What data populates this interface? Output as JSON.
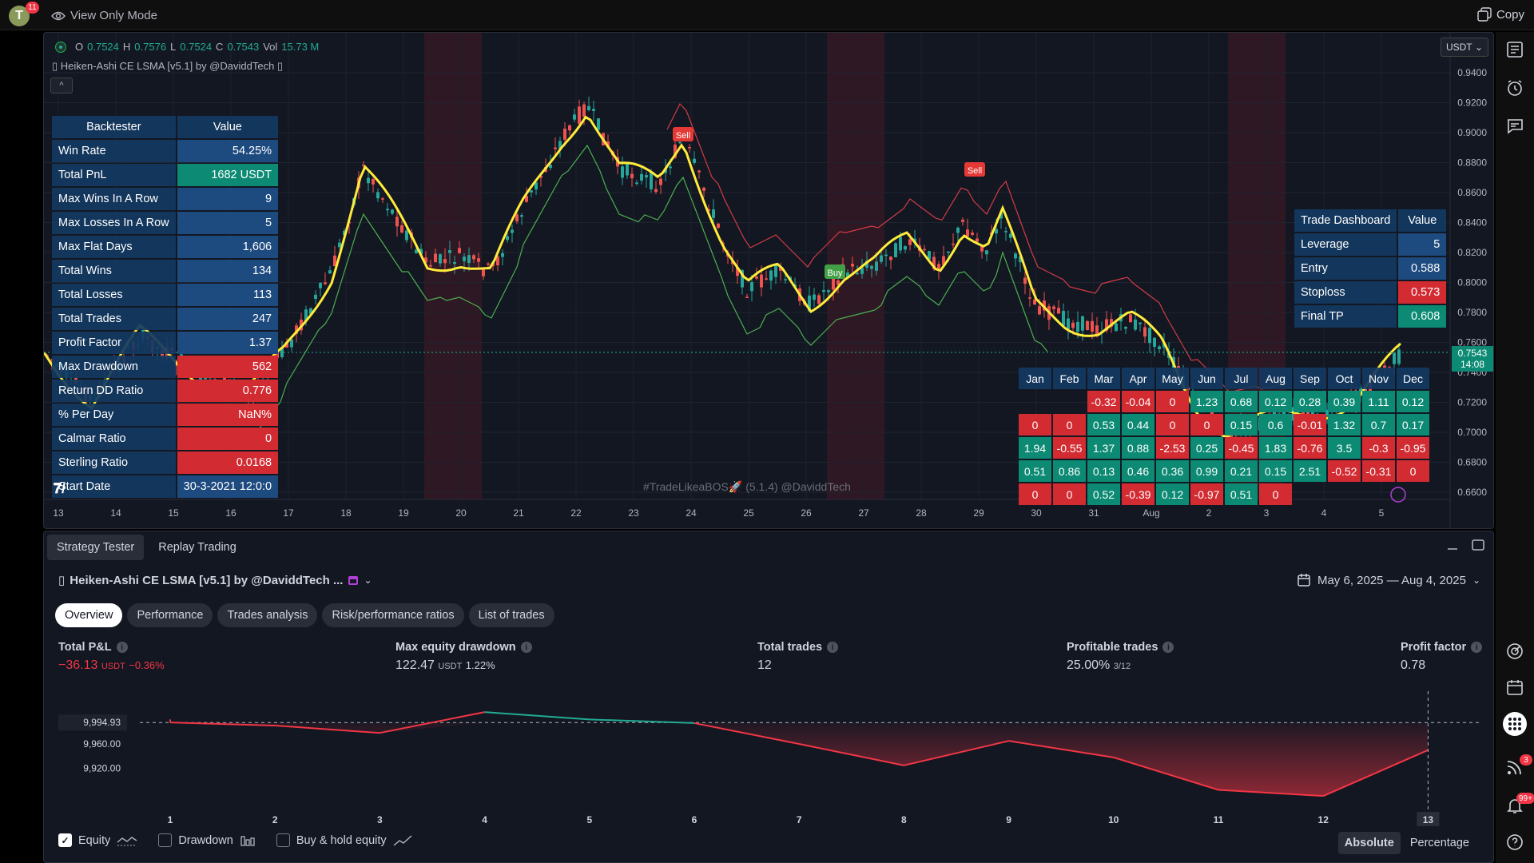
{
  "topbar": {
    "avatar_letter": "T",
    "avatar_badge": "11",
    "view_mode": "View Only Mode",
    "copy_label": "Copy"
  },
  "chart": {
    "ohlc": {
      "o_label": "O",
      "o": "0.7524",
      "h_label": "H",
      "h": "0.7576",
      "l_label": "L",
      "l": "0.7524",
      "c_label": "C",
      "c": "0.7543",
      "vol_label": "Vol",
      "vol": "15.73 M"
    },
    "indicator_title": "Heiken-Ashi CE LSMA [v5.1] by @DaviddTech",
    "currency": "USDT",
    "watermark": "#TradeLikeaBOS🚀 (5.1.4) @DaviddTech",
    "price_labels": [
      "0.9400",
      "0.9200",
      "0.9000",
      "0.8800",
      "0.8600",
      "0.8400",
      "0.8200",
      "0.8000",
      "0.7800",
      "0.7600",
      "0.7400",
      "0.7200",
      "0.7000",
      "0.6800",
      "0.6600"
    ],
    "current_price": "0.7543",
    "current_time": "14:08",
    "time_labels": [
      "13",
      "14",
      "15",
      "16",
      "17",
      "18",
      "19",
      "20",
      "21",
      "22",
      "23",
      "24",
      "25",
      "26",
      "27",
      "28",
      "29",
      "30",
      "31",
      "Aug",
      "2",
      "3",
      "4",
      "5"
    ],
    "signals": [
      {
        "label": "Sell"
      },
      {
        "label": "Sell"
      },
      {
        "label": "Buy"
      }
    ],
    "colors": {
      "up": "#26a69a",
      "down": "#ef5350",
      "lsma": "#ffeb3b",
      "bg": "#131722"
    }
  },
  "backtester": {
    "header_key": "Backtester",
    "header_val": "Value",
    "rows": [
      {
        "k": "Win Rate",
        "v": "54.25%",
        "c": "blue"
      },
      {
        "k": "Total PnL",
        "v": "1682 USDT",
        "c": "teal"
      },
      {
        "k": "Max Wins In A Row",
        "v": "9",
        "c": "blue"
      },
      {
        "k": "Max Losses In A Row",
        "v": "5",
        "c": "blue"
      },
      {
        "k": "Max Flat Days",
        "v": "1,606",
        "c": "blue"
      },
      {
        "k": "Total Wins",
        "v": "134",
        "c": "blue"
      },
      {
        "k": "Total Losses",
        "v": "113",
        "c": "blue"
      },
      {
        "k": "Total Trades",
        "v": "247",
        "c": "blue"
      },
      {
        "k": "Profit Factor",
        "v": "1.37",
        "c": "blue"
      },
      {
        "k": "Max Drawdown",
        "v": "562",
        "c": "red"
      },
      {
        "k": "Return DD Ratio",
        "v": "0.776",
        "c": "red"
      },
      {
        "k": "% Per Day",
        "v": "NaN%",
        "c": "red"
      },
      {
        "k": "Calmar Ratio",
        "v": "0",
        "c": "red"
      },
      {
        "k": "Sterling Ratio",
        "v": "0.0168",
        "c": "red"
      },
      {
        "k": "Start Date",
        "v": "30-3-2021 12:0:0",
        "c": "blue"
      }
    ]
  },
  "trade_dashboard": {
    "header_key": "Trade Dashboard",
    "header_val": "Value",
    "rows": [
      {
        "k": "Leverage",
        "v": "5",
        "c": "blue"
      },
      {
        "k": "Entry",
        "v": "0.588",
        "c": "blue"
      },
      {
        "k": "Stoploss",
        "v": "0.573",
        "c": "red"
      },
      {
        "k": "Final TP",
        "v": "0.608",
        "c": "teal"
      }
    ]
  },
  "monthly": {
    "months": [
      "Jan",
      "Feb",
      "Mar",
      "Apr",
      "May",
      "Jun",
      "Jul",
      "Aug",
      "Sep",
      "Oct",
      "Nov",
      "Dec"
    ],
    "rows": [
      [
        "",
        "",
        "-0.32",
        "-0.04",
        "0",
        "1.23",
        "0.68",
        "0.12",
        "0.28",
        "0.39",
        "1.11",
        "0.12"
      ],
      [
        "0",
        "0",
        "0.53",
        "0.44",
        "0",
        "0",
        "0.15",
        "0.6",
        "-0.01",
        "1.32",
        "0.7",
        "0.17"
      ],
      [
        "1.94",
        "-0.55",
        "1.37",
        "0.88",
        "-2.53",
        "0.25",
        "-0.45",
        "1.83",
        "-0.76",
        "3.5",
        "-0.3",
        "-0.95"
      ],
      [
        "0.51",
        "0.86",
        "0.13",
        "0.46",
        "0.36",
        "0.99",
        "0.21",
        "0.15",
        "2.51",
        "-0.52",
        "-0.31",
        "0"
      ],
      [
        "0",
        "0",
        "0.52",
        "-0.39",
        "0.12",
        "-0.97",
        "0.51",
        "0",
        "",
        "",
        "",
        ""
      ]
    ]
  },
  "right_toolbar": {
    "badge_feed": "3",
    "badge_notif": "99+"
  },
  "bottom": {
    "tabs": [
      {
        "label": "Strategy Tester"
      },
      {
        "label": "Replay Trading"
      }
    ],
    "strategy_name": "Heiken-Ashi CE LSMA [v5.1] by @DaviddTech ...",
    "date_range": "May 6, 2025 — Aug 4, 2025",
    "subtabs": [
      {
        "label": "Overview"
      },
      {
        "label": "Performance"
      },
      {
        "label": "Trades analysis"
      },
      {
        "label": "Risk/performance ratios"
      },
      {
        "label": "List of trades"
      }
    ],
    "metrics": {
      "pnl": {
        "label": "Total P&L",
        "value": "−36.13",
        "unit": "USDT",
        "pct": "−0.36%"
      },
      "dd": {
        "label": "Max equity drawdown",
        "value": "122.47",
        "unit": "USDT",
        "pct": "1.22%"
      },
      "trades": {
        "label": "Total trades",
        "value": "12"
      },
      "profitable": {
        "label": "Profitable trades",
        "value": "25.00%",
        "sub": "3/12"
      },
      "pf": {
        "label": "Profit factor",
        "value": "0.78"
      }
    },
    "legend": {
      "equity": "Equity",
      "drawdown": "Drawdown",
      "buyhold": "Buy & hold equity"
    },
    "mode": {
      "absolute": "Absolute",
      "percentage": "Percentage"
    }
  },
  "chart_data": {
    "type": "line",
    "title": "",
    "xlabel": "",
    "ylabel": "",
    "x": [
      1,
      2,
      3,
      4,
      5,
      6,
      7,
      8,
      9,
      10,
      11,
      12,
      13
    ],
    "series": [
      {
        "name": "Equity",
        "values": [
          9995,
          9990,
          9978,
          10012,
          10000,
          9994,
          9960,
          9925,
          9965,
          9938,
          9885,
          9875,
          9950
        ]
      }
    ],
    "start_x": 0,
    "start_value": 10000,
    "y_ticks": [
      "9,994.93",
      "9,960.00",
      "9,920.00"
    ],
    "ylim": [
      9870,
      10020
    ],
    "reference_line": 9994.93,
    "highlight_x": "13",
    "colors": {
      "below": "#f23645",
      "above": "#22ab94"
    }
  }
}
